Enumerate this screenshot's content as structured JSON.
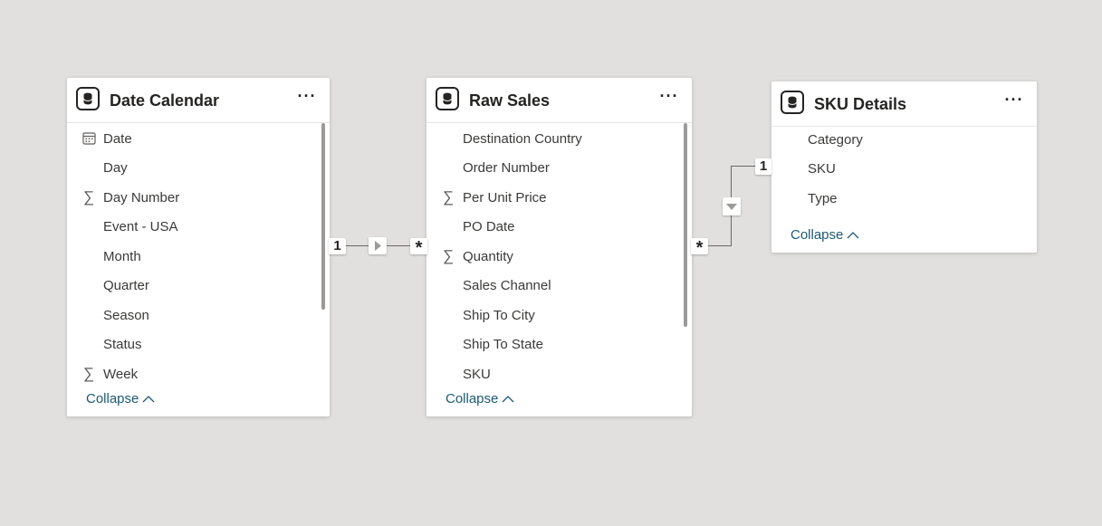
{
  "tables": [
    {
      "name": "Date Calendar",
      "fields": [
        {
          "label": "Date",
          "icon": "calendar-icon"
        },
        {
          "label": "Day",
          "icon": ""
        },
        {
          "label": "Day Number",
          "icon": "sigma-icon"
        },
        {
          "label": "Event - USA",
          "icon": ""
        },
        {
          "label": "Month",
          "icon": ""
        },
        {
          "label": "Quarter",
          "icon": ""
        },
        {
          "label": "Season",
          "icon": ""
        },
        {
          "label": "Status",
          "icon": ""
        },
        {
          "label": "Week",
          "icon": "sigma-icon"
        }
      ],
      "collapse_label": "Collapse"
    },
    {
      "name": "Raw Sales",
      "fields": [
        {
          "label": "Destination Country",
          "icon": ""
        },
        {
          "label": "Order Number",
          "icon": ""
        },
        {
          "label": "Per Unit Price",
          "icon": "sigma-icon"
        },
        {
          "label": "PO Date",
          "icon": ""
        },
        {
          "label": "Quantity",
          "icon": "sigma-icon"
        },
        {
          "label": "Sales Channel",
          "icon": ""
        },
        {
          "label": "Ship To City",
          "icon": ""
        },
        {
          "label": "Ship To State",
          "icon": ""
        },
        {
          "label": "SKU",
          "icon": ""
        }
      ],
      "collapse_label": "Collapse"
    },
    {
      "name": "SKU Details",
      "fields": [
        {
          "label": "Category",
          "icon": ""
        },
        {
          "label": "SKU",
          "icon": ""
        },
        {
          "label": "Type",
          "icon": ""
        }
      ],
      "collapse_label": "Collapse"
    }
  ],
  "relationships": [
    {
      "from_table": "Date Calendar",
      "to_table": "Raw Sales",
      "from_cardinality": "1",
      "to_cardinality": "*",
      "filter_direction": "right"
    },
    {
      "from_table": "SKU Details",
      "to_table": "Raw Sales",
      "from_cardinality": "1",
      "to_cardinality": "*",
      "filter_direction": "down"
    }
  ],
  "more_menu_glyph": "···",
  "sigma_glyph": "∑",
  "collapse_chevron": "^",
  "colors": {
    "canvas": "#e1e0de",
    "card": "#ffffff",
    "link": "#1c5a73",
    "text": "#252423"
  }
}
